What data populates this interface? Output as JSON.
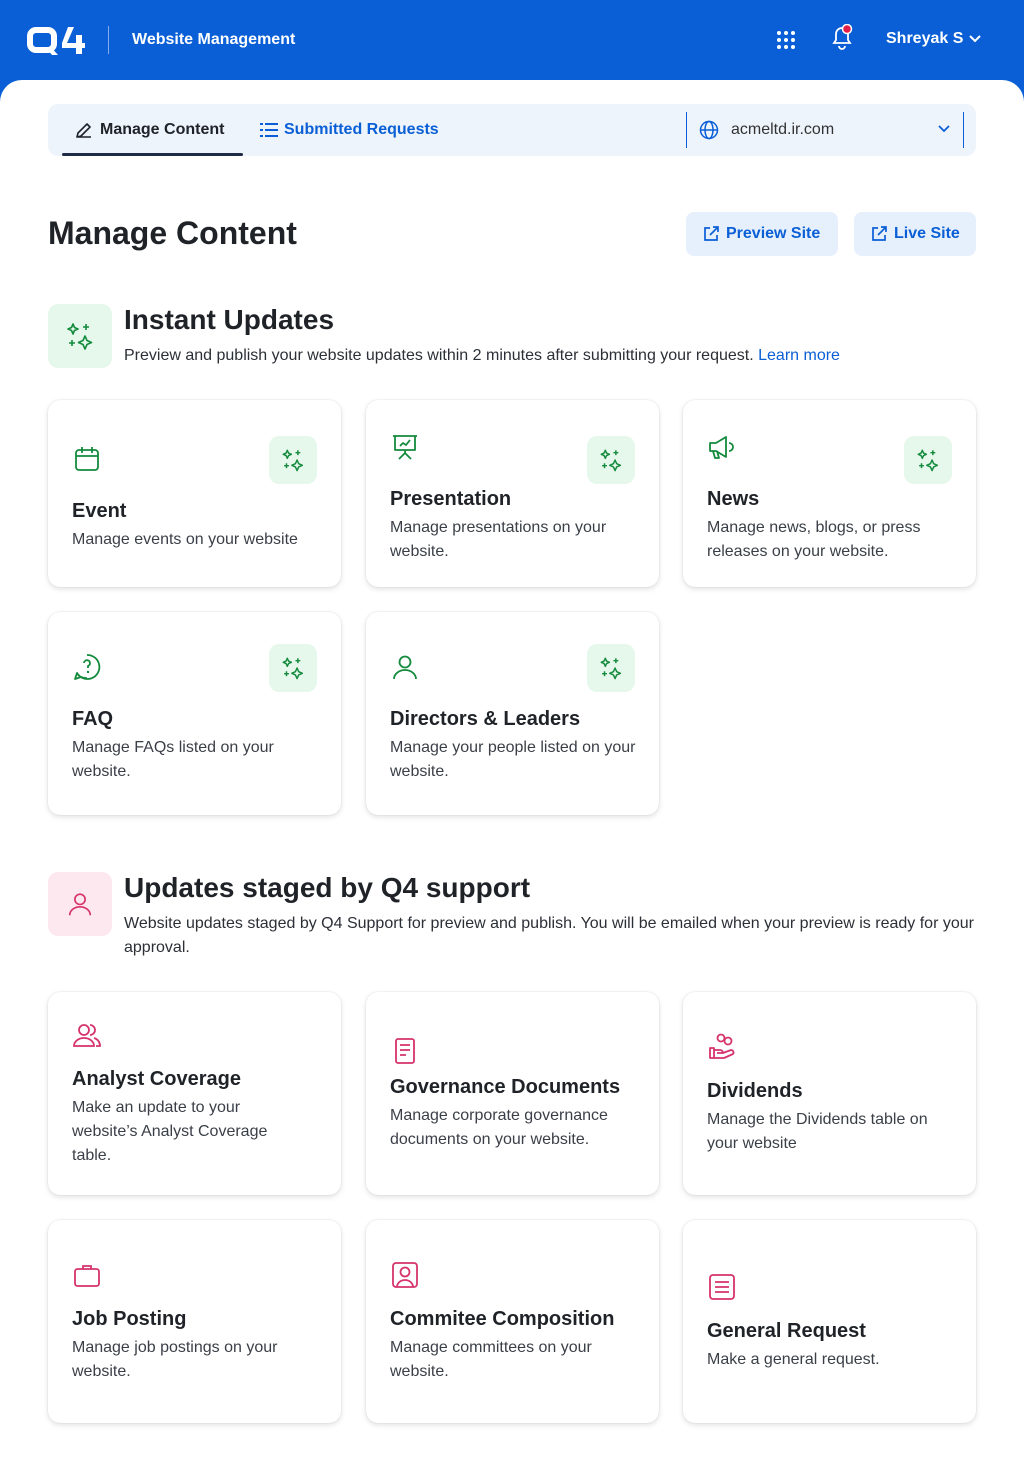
{
  "header": {
    "app_title": "Website Management",
    "user_name": "Shreyak S",
    "icons": {
      "logo": "q4-logo",
      "apps": "grid-icon",
      "notifications": "bell-icon"
    }
  },
  "tabs": {
    "manage_content": "Manage Content",
    "submitted_requests": "Submitted Requests"
  },
  "site_selector": {
    "value": "acmeltd.ir.com"
  },
  "page": {
    "title": "Manage Content",
    "preview_label": "Preview Site",
    "live_label": "Live Site"
  },
  "instant": {
    "title": "Instant Updates",
    "desc": "Preview and publish your website updates within 2 minutes after submitting your request.",
    "learn_more": "Learn more",
    "cards": [
      {
        "title": "Event",
        "desc": "Manage events on your website",
        "icon": "calendar-icon"
      },
      {
        "title": "Presentation",
        "desc": "Manage presentations on your website.",
        "icon": "presentation-icon"
      },
      {
        "title": "News",
        "desc": "Manage news, blogs, or press releases on your website.",
        "icon": "megaphone-icon"
      },
      {
        "title": "FAQ",
        "desc": "Manage FAQs listed on your website.",
        "icon": "question-chat-icon"
      },
      {
        "title": "Directors & Leaders",
        "desc": "Manage your people listed on your website.",
        "icon": "person-icon"
      }
    ]
  },
  "staged": {
    "title": "Updates staged by Q4 support",
    "desc": "Website updates staged by Q4 Support for preview and publish. You will be emailed when your preview is ready for your approval.",
    "cards": [
      {
        "title": "Analyst Coverage",
        "desc": "Make an update to your website’s Analyst Coverage table.",
        "icon": "users-icon"
      },
      {
        "title": "Governance Documents",
        "desc": "Manage corporate governance documents on your website.",
        "icon": "document-icon"
      },
      {
        "title": "Dividends",
        "desc": "Manage the Dividends table on your website",
        "icon": "dividends-icon"
      },
      {
        "title": "Job Posting",
        "desc": "Manage job postings on your website.",
        "icon": "briefcase-icon"
      },
      {
        "title": "Commitee Composition",
        "desc": "Manage committees on your website.",
        "icon": "id-card-icon"
      },
      {
        "title": "General Request",
        "desc": "Make a general request.",
        "icon": "list-icon"
      }
    ]
  },
  "colors": {
    "brand": "#0a5fd6",
    "green": "#138a3c",
    "pink": "#d6336c"
  }
}
